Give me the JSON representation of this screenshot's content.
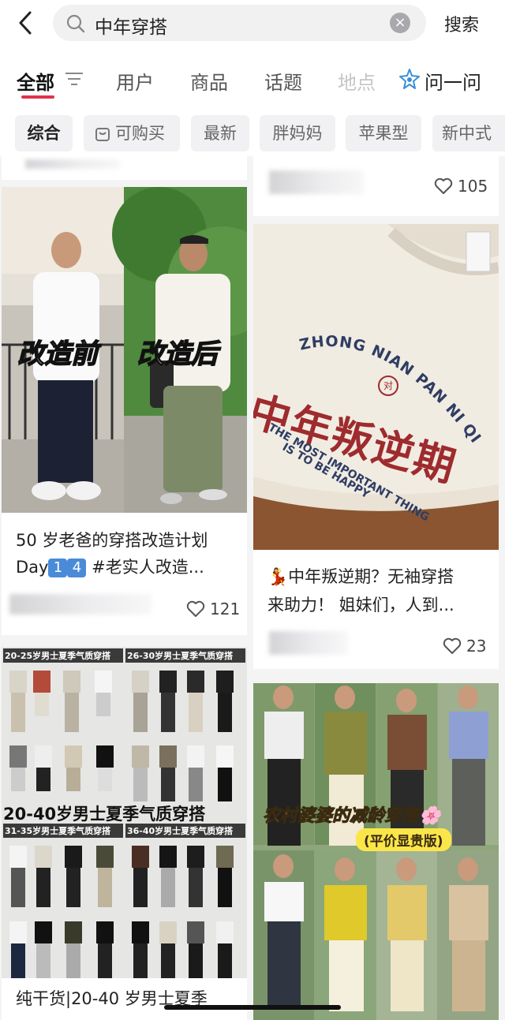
{
  "search": {
    "query": "中年穿搭",
    "button": "搜索"
  },
  "tabs": [
    "全部",
    "用户",
    "商品",
    "话题",
    "地点"
  ],
  "ask": "问一问",
  "chips": [
    "综合",
    "可购买",
    "最新",
    "胖妈妈",
    "苹果型",
    "新中式"
  ],
  "cards": {
    "left1": {
      "overlay_before": "改造前",
      "overlay_after": "改造后",
      "title_line1": "50 岁老爸的穿搭改造计划",
      "title_day": "Day",
      "title_num1": "1",
      "title_num2": "4",
      "title_rest": " #老实人改造...",
      "likes": "121"
    },
    "right0": {
      "likes": "105"
    },
    "right1": {
      "shirt_arc": "ZHONG NIAN PAN NI QI",
      "shirt_main": "中年叛逆期",
      "shirt_sub1": "THE MOST IMPORTANT THING",
      "shirt_sub2": "IS TO BE HAPPY",
      "title_emoji": "💃",
      "title_line1": "中年叛逆期？无袖穿搭",
      "title_line2": "来助力！ 姐妹们，人到...",
      "likes": "23"
    },
    "left2": {
      "panel_labels": [
        "20-25岁男士夏季气质穿搭",
        "26-30岁男士夏季气质穿搭",
        "31-35岁男士夏季气质穿搭",
        "36-40岁男士夏季气质穿搭"
      ],
      "banner": "20-40岁男士夏季气质穿搭",
      "title_line1": "纯干货|20-40 岁男士夏季"
    },
    "right2": {
      "banner": "农村婆婆的减龄穿搭🌸",
      "sub_banner": "(平价显贵版)"
    }
  },
  "colors": {
    "accent": "#e0324a",
    "shirt_text_red": "#9e2b2e",
    "shirt_text_navy": "#2f3d63"
  }
}
